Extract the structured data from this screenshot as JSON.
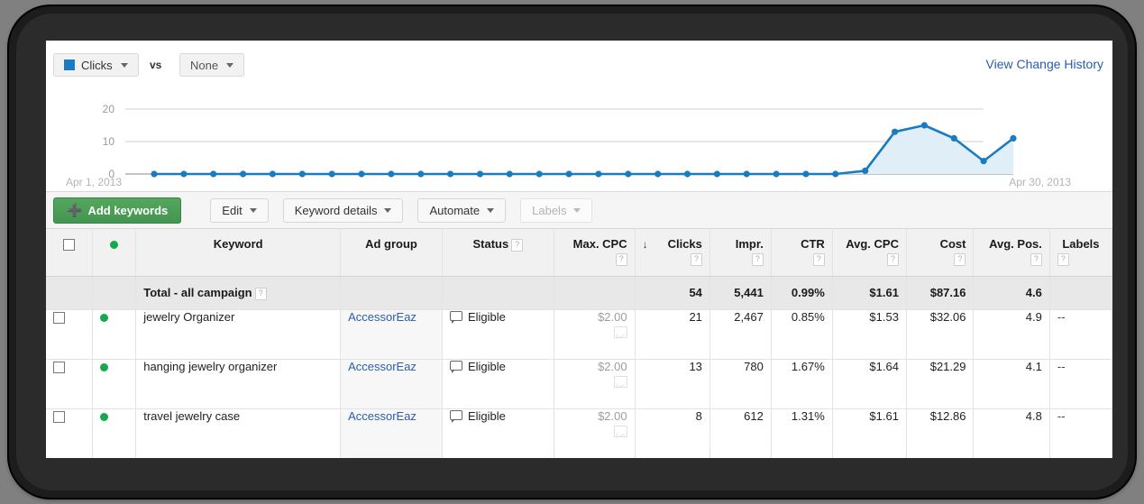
{
  "metric_bar": {
    "primary_metric": "Clicks",
    "primary_color": "#1a7cc0",
    "vs_label": "vs",
    "compare_metric": "None",
    "change_history_link": "View Change History"
  },
  "chart": {
    "y_ticks": [
      "20",
      "10",
      "0"
    ],
    "date_start": "Apr 1, 2013",
    "date_end": "Apr 30, 2013"
  },
  "chart_data": {
    "type": "line",
    "title": "",
    "xlabel": "",
    "ylabel": "Clicks",
    "ylim": [
      0,
      20
    ],
    "grid": true,
    "legend_position": "top-left",
    "series": [
      {
        "name": "Clicks",
        "color": "#1a7cc0",
        "values": [
          0,
          0,
          0,
          0,
          0,
          0,
          0,
          0,
          0,
          0,
          0,
          0,
          0,
          0,
          0,
          0,
          0,
          0,
          0,
          0,
          0,
          0,
          0,
          0,
          1,
          13,
          15,
          11,
          4,
          11
        ]
      }
    ],
    "categories": [
      "Apr 1, 2013",
      "Apr 2, 2013",
      "Apr 3, 2013",
      "Apr 4, 2013",
      "Apr 5, 2013",
      "Apr 6, 2013",
      "Apr 7, 2013",
      "Apr 8, 2013",
      "Apr 9, 2013",
      "Apr 10, 2013",
      "Apr 11, 2013",
      "Apr 12, 2013",
      "Apr 13, 2013",
      "Apr 14, 2013",
      "Apr 15, 2013",
      "Apr 16, 2013",
      "Apr 17, 2013",
      "Apr 18, 2013",
      "Apr 19, 2013",
      "Apr 20, 2013",
      "Apr 21, 2013",
      "Apr 22, 2013",
      "Apr 23, 2013",
      "Apr 24, 2013",
      "Apr 25, 2013",
      "Apr 26, 2013",
      "Apr 27, 2013",
      "Apr 28, 2013",
      "Apr 29, 2013",
      "Apr 30, 2013"
    ]
  },
  "toolbar": {
    "add_keywords": "Add keywords",
    "edit": "Edit",
    "keyword_details": "Keyword details",
    "automate": "Automate",
    "labels": "Labels"
  },
  "table": {
    "headers": {
      "keyword": "Keyword",
      "ad_group": "Ad group",
      "status": "Status",
      "max_cpc": "Max. CPC",
      "clicks": "Clicks",
      "impr": "Impr.",
      "ctr": "CTR",
      "avg_cpc": "Avg. CPC",
      "cost": "Cost",
      "avg_pos": "Avg. Pos.",
      "labels": "Labels"
    },
    "help_glyph": "?",
    "sort_arrow": "↓",
    "sorted_column": "clicks",
    "total_row": {
      "label": "Total - all campaign",
      "clicks": "54",
      "impr": "5,441",
      "ctr": "0.99%",
      "avg_cpc": "$1.61",
      "cost": "$87.16",
      "avg_pos": "4.6"
    },
    "rows": [
      {
        "keyword": "jewelry Organizer",
        "ad_group": "AccessorEaz",
        "status": "Eligible",
        "max_cpc": "$2.00",
        "clicks": "21",
        "impr": "2,467",
        "ctr": "0.85%",
        "avg_cpc": "$1.53",
        "cost": "$32.06",
        "avg_pos": "4.9",
        "labels": "--"
      },
      {
        "keyword": "hanging jewelry organizer",
        "ad_group": "AccessorEaz",
        "status": "Eligible",
        "max_cpc": "$2.00",
        "clicks": "13",
        "impr": "780",
        "ctr": "1.67%",
        "avg_cpc": "$1.64",
        "cost": "$21.29",
        "avg_pos": "4.1",
        "labels": "--"
      },
      {
        "keyword": "travel jewelry case",
        "ad_group": "AccessorEaz",
        "status": "Eligible",
        "max_cpc": "$2.00",
        "clicks": "8",
        "impr": "612",
        "ctr": "1.31%",
        "avg_cpc": "$1.61",
        "cost": "$12.86",
        "avg_pos": "4.8",
        "labels": "--"
      }
    ]
  }
}
